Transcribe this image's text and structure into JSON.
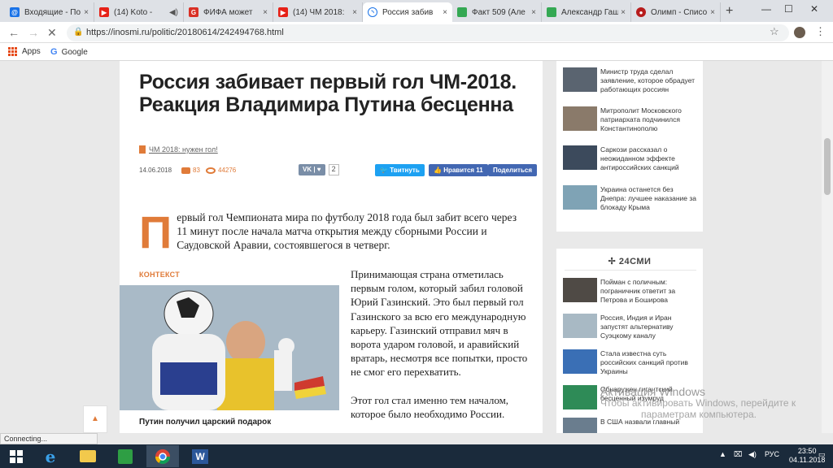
{
  "browser": {
    "tabs": [
      {
        "title": "Входящие - По",
        "color": "#1a73e8"
      },
      {
        "title": "(14) Koto -",
        "color": "#e62117"
      },
      {
        "title": "ФИФА может",
        "color": "#d93025"
      },
      {
        "title": "(14) ЧМ 2018:",
        "color": "#e62117"
      },
      {
        "title": "Россия забив",
        "color": "#1a73e8"
      },
      {
        "title": "Факт 509 (Але",
        "color": "#34a853"
      },
      {
        "title": "Александр Гаш",
        "color": "#34a853"
      },
      {
        "title": "Олимп - Списо",
        "color": "#b71c1c"
      }
    ],
    "new_tab": "+",
    "window_controls": [
      "—",
      "☐",
      "✕"
    ],
    "url": "https://inosmi.ru/politic/20180614/242494768.html",
    "bookmarks": [
      {
        "label": "Apps"
      },
      {
        "label": "Google"
      }
    ]
  },
  "article": {
    "title": "Россия забивает первый гол ЧМ-2018. Реакция Владимира Путина бесценна",
    "tag": "ЧМ 2018: нужен гол!",
    "date": "14.06.2018",
    "comments": "83",
    "views": "44276",
    "share": {
      "vk_label": "VK",
      "vk_count": "2",
      "twitter": "Твитнуть",
      "like": "Нравится 11",
      "share": "Поделиться",
      "colors": {
        "twitter": "#1da1f2",
        "facebook": "#4267b2"
      }
    },
    "dropcap": "П",
    "lede": "ервый гол Чемпионата мира по футболу 2018 года был забит всего через 11 минут после начала матча открытия между сборными России и Саудовской Аравии, состоявшегося в четверг.",
    "context_label": "КОНТЕКСТ",
    "photo_caption": "Путин получил царский подарок",
    "body": [
      "Принимающая страна отметилась первым голом, который забил головой Юрий Газинский. Это был первый гол Газинского за всю его международную карьеру. Газинский отправил мяч в ворота ударом головой, и аравийский вратарь, несмотря все попытки, просто не смог его перехватить.",
      "Этот гол стал именно тем началом, которое было необходимо России."
    ],
    "accent_color": "#e07b39"
  },
  "sidebar_top": [
    {
      "text": "Министр труда сделал заявление, которое обрадует работающих россиян",
      "thumb": "#5a6470"
    },
    {
      "text": "Митрополит Московского патриархата подчинился Константинополю",
      "thumb": "#8a7a6a"
    },
    {
      "text": "Саркози рассказал о неожиданном эффекте антироссийских санкций",
      "thumb": "#3c4a5c"
    },
    {
      "text": "Украина останется без Днепра: лучшее наказание за блокаду Крыма",
      "thumb": "#7fa3b5"
    }
  ],
  "sidebar_24smi": {
    "heading": "24СМИ",
    "items": [
      {
        "text": "Пойман с поличным: пограничник ответит за Петрова и Боширова",
        "thumb": "#4f4a45"
      },
      {
        "text": "Россия, Индия и Иран запустят альтернативу Суэцкому каналу",
        "thumb": "#a8b9c4"
      },
      {
        "text": "Стала известна суть российских санкций против Украины",
        "thumb": "#3a6fb5"
      },
      {
        "text": "Обнаружен гигантский бесценный изумруд",
        "thumb": "#2e8b57"
      },
      {
        "text": "В США назвали главный",
        "thumb": "#6a7d8e"
      }
    ]
  },
  "watermark": {
    "line1": "Активация Windows",
    "line2": "Чтобы активировать Windows, перейдите к",
    "line3": "параметрам компьютера."
  },
  "status_text": "Connecting...",
  "taskbar": {
    "lang": "РУС",
    "time": "23:50",
    "date": "04.11.2018"
  }
}
